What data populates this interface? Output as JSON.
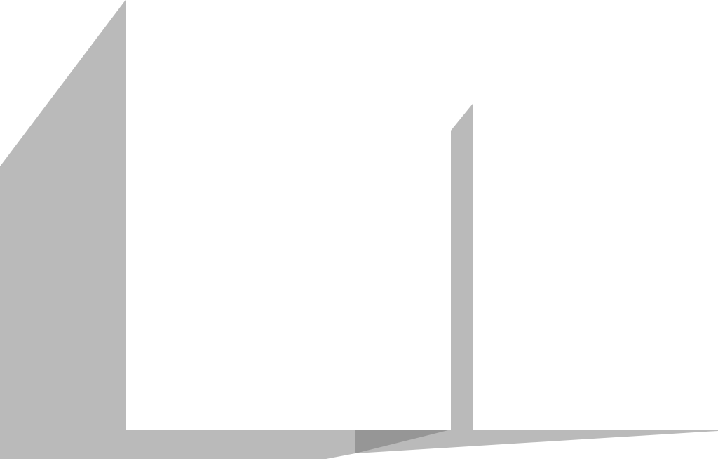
{
  "colors": {
    "background": "#ffffff",
    "shadow": "#bababa",
    "shadow_dark": "#969696"
  },
  "scene": {
    "shapes": [
      {
        "name": "left-wedge-shadow",
        "fill": "shadow"
      },
      {
        "name": "floor-shadow-band",
        "fill": "shadow"
      },
      {
        "name": "floor-shadow-dark-patch",
        "fill": "shadow_dark"
      },
      {
        "name": "vertical-divider-shadow",
        "fill": "shadow"
      },
      {
        "name": "right-floor-shadow-sliver",
        "fill": "shadow"
      }
    ]
  }
}
